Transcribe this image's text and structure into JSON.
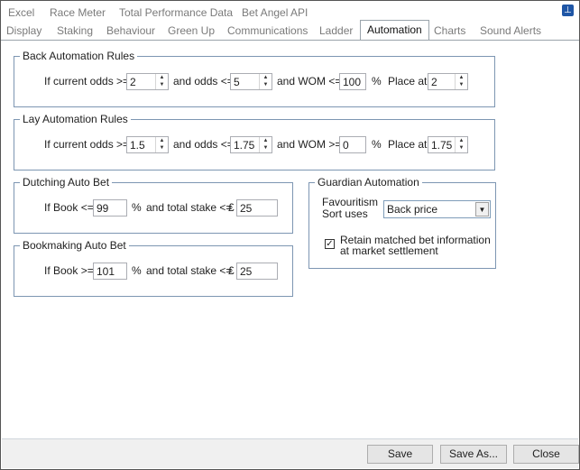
{
  "tabs_row1": [
    "Excel",
    "Race Meter",
    "Total Performance Data",
    "Bet Angel API"
  ],
  "tabs_row2": [
    "Display",
    "Staking",
    "Behaviour",
    "Green Up",
    "Communications",
    "Ladder",
    "Automation",
    "Charts",
    "Sound Alerts"
  ],
  "active_tab": "Automation",
  "back_rules": {
    "title": "Back Automation Rules",
    "if_current_odds": "If current odds >=",
    "current_odds": "2",
    "and_odds": "and odds <=",
    "odds": "5",
    "and_wom": "and WOM <=",
    "wom": "100",
    "pct": "%",
    "place_at": "Place at",
    "place": "2"
  },
  "lay_rules": {
    "title": "Lay Automation Rules",
    "if_current_odds": "If current odds >=",
    "current_odds": "1.5",
    "and_odds": "and odds <=",
    "odds": "1.75",
    "and_wom": "and WOM >=",
    "wom": "0",
    "pct": "%",
    "place_at": "Place at",
    "place": "1.75"
  },
  "dutching": {
    "title": "Dutching Auto Bet",
    "if_book": "If Book <=",
    "book": "99",
    "pct": "%",
    "and_stake": "and total stake <=",
    "currency": "£",
    "stake": "25"
  },
  "bookmaking": {
    "title": "Bookmaking Auto Bet",
    "if_book": "If Book >=",
    "book": "101",
    "pct": "%",
    "and_stake": "and total stake <=",
    "currency": "£",
    "stake": "25"
  },
  "guardian": {
    "title": "Guardian Automation",
    "fav_label_1": "Favouritism",
    "fav_label_2": "Sort uses",
    "sort_value": "Back price",
    "retain_checked": true,
    "retain_line1": "Retain matched bet information",
    "retain_line2": "at market settlement"
  },
  "buttons": {
    "save": "Save",
    "save_as": "Save As...",
    "close": "Close"
  }
}
